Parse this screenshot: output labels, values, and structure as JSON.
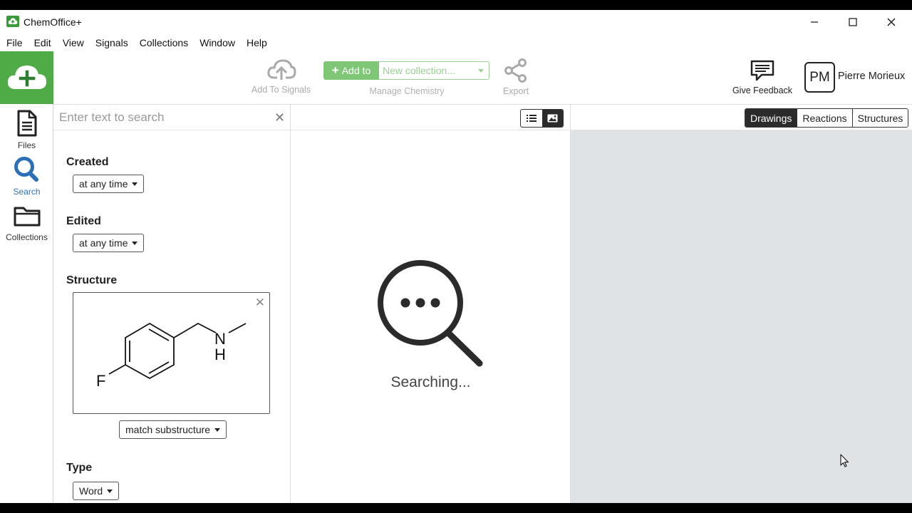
{
  "window": {
    "title": "ChemOffice+"
  },
  "menu": [
    "File",
    "Edit",
    "View",
    "Signals",
    "Collections",
    "Window",
    "Help"
  ],
  "nav": {
    "files": "Files",
    "search": "Search",
    "collections": "Collections"
  },
  "toolbar": {
    "add_to_signals": "Add To Signals",
    "add_to": "Add to",
    "collection_placeholder": "New collection...",
    "manage_chemistry": "Manage Chemistry",
    "export": "Export",
    "give_feedback": "Give Feedback",
    "user_initials": "PM",
    "user_name": "Pierre Morieux"
  },
  "filters": {
    "search_placeholder": "Enter text to search",
    "created_label": "Created",
    "created_value": "at any time",
    "edited_label": "Edited",
    "edited_value": "at any time",
    "structure_label": "Structure",
    "structure_atoms": {
      "fluorine": "F",
      "nitrogen": "N",
      "hydrogen": "H"
    },
    "structure_match": "match substructure",
    "type_label": "Type",
    "type_value": "Word"
  },
  "results": {
    "status": "Searching..."
  },
  "preview": {
    "tabs": [
      "Drawings",
      "Reactions",
      "Structures"
    ],
    "active_tab": "Drawings"
  },
  "colors": {
    "brand_green": "#4fab45",
    "add_to_green": "#7fc777",
    "preview_bg": "#dfe3e5",
    "active_dark": "#2b2b2b"
  }
}
